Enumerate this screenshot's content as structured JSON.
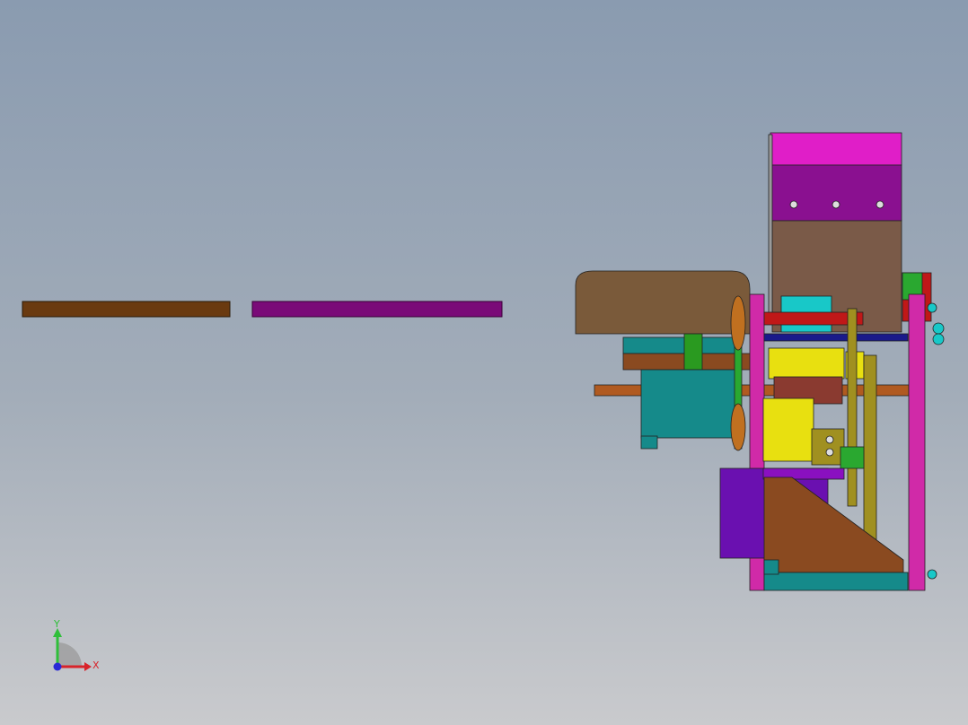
{
  "viewport": {
    "background_top": "#8a9bb0",
    "background_bottom": "#c9cacd"
  },
  "triad": {
    "x_label": "X",
    "y_label": "Y",
    "x_color": "#d8232a",
    "y_color": "#2fbf3a",
    "z_color": "#2a2ad6"
  },
  "parts": {
    "brown_bar_color": "#6a3a10",
    "purple_bar_color": "#7a0a78",
    "magenta_color": "#d02aa8",
    "bright_magenta_color": "#e01ec8",
    "teal_color": "#158a8a",
    "cyan_color": "#18c8c8",
    "yellow_color": "#e8e010",
    "olive_color": "#a09020",
    "violet_color": "#6a10b0",
    "wood_color": "#7a5a3a",
    "copper_color": "#b05a20",
    "green_color": "#2aa830"
  }
}
